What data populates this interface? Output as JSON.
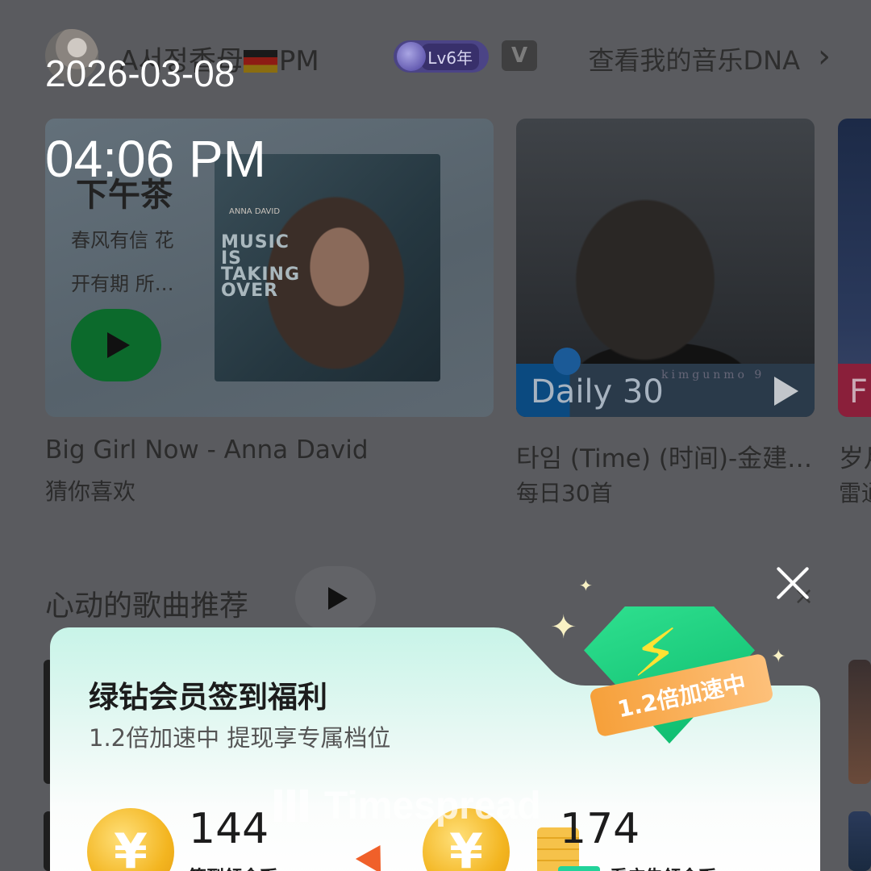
{
  "overlay": {
    "date": "2026-03-08",
    "time": "04:06 PM"
  },
  "userbar": {
    "username": "A서정香母",
    "username_suffix": "PM",
    "level_badge": "Lv6年",
    "vip_icon_letter": "V",
    "dna_link": "查看我的音乐DNA"
  },
  "cards": [
    {
      "title": "下午茶",
      "description": "春风有信 花开有期 所…",
      "album_artist_small": "ANNA DAVID",
      "album_text": "MUSIC IS TAKING OVER",
      "caption": "Big Girl Now - Anna David",
      "subcaption": "猜你喜欢"
    },
    {
      "label": "Daily 30",
      "watermark": "kimgunmo 9",
      "caption": "타임 (Time) (时间)-金建…",
      "subcaption": "每日30首"
    },
    {
      "label": "F",
      "caption": "岁月",
      "subcaption": "雷通"
    }
  ],
  "section": {
    "title": "心动的歌曲推荐",
    "more_icon": "×"
  },
  "popup": {
    "title": "绿钻会员签到福利",
    "subtitle": "1.2倍加速中 提现享专属档位",
    "badge_text": "1.2倍加速中",
    "coin_symbol": "¥",
    "left_amount": "144",
    "left_label": "签到领金币",
    "right_amount": "174",
    "right_label": "看广告领金币"
  },
  "watermark": "Timespread",
  "colors": {
    "background_dim": "#5a5b5f",
    "accent_green": "#0c6a2c",
    "popup_top": "#c8f4e8",
    "coin": "#f3b520",
    "ribbon": "#f6a03a"
  }
}
